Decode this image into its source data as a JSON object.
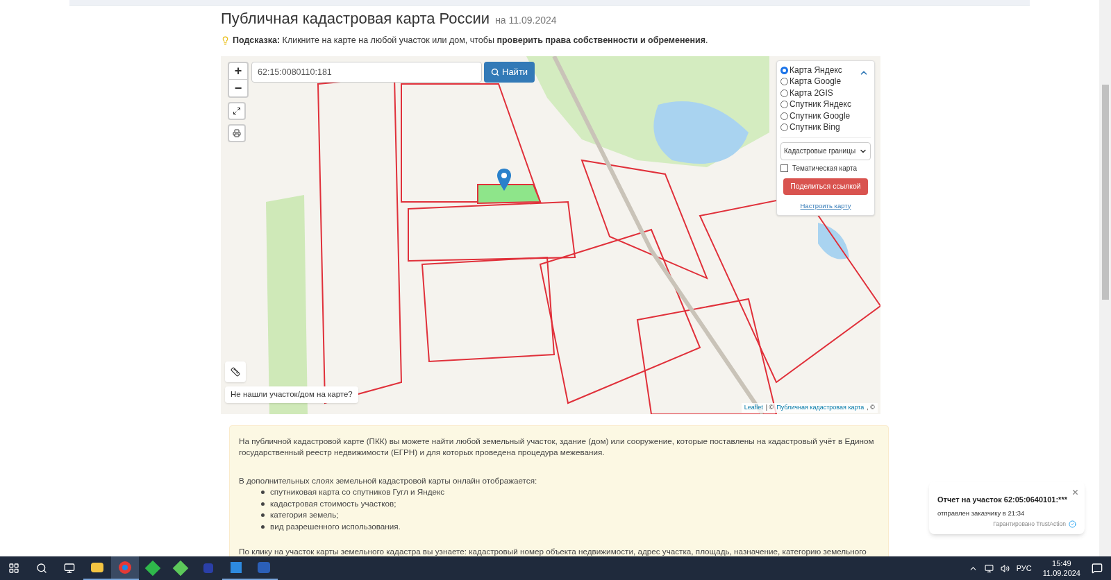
{
  "header": {
    "title": "Публичная кадастровая карта России",
    "date": "на 11.09.2024",
    "hint": "**Подсказка:** Кликните на карте на любой участок или дом, чтобы **проверить права собственности и обременения**."
  },
  "map": {
    "zoom_in": "+",
    "zoom_out": "−",
    "search": {
      "value": "62:15:0080110:181"
    },
    "search_button": "Найти",
    "layers": [
      {
        "label": "Карта Яндекс",
        "selected": true
      },
      {
        "label": "Карта Google",
        "selected": false
      },
      {
        "label": "Карта 2GIS",
        "selected": false
      },
      {
        "label": "Спутник Яндекс",
        "selected": false
      },
      {
        "label": "Спутник Google",
        "selected": false
      },
      {
        "label": "Спутник Bing",
        "selected": false
      }
    ],
    "overlay_select": "Кадастровые границы",
    "thematic": {
      "label": "Тематическая карта",
      "checked": false
    },
    "share_button": "Поделиться ссылкой",
    "settings_link": "Настроить карту",
    "not_found_button": "Не нашли участок/дом на карте?",
    "attribution": {
      "leaflet": "Leaflet",
      "separator": "| ©",
      "source": "Публичная кадастровая карта",
      "tail": ", ©"
    }
  },
  "info": {
    "paragraph_1": "На публичной кадастровой карте (ПКК) вы можете найти любой земельный участок, здание (дом) или сооружение, которые поставлены на кадастровый учёт в Едином государственный реестр недвижимости (ЕГРН) и для которых проведена процедура межевания.",
    "paragraph_2": "В дополнительных слоях земельной кадастровой карты онлайн отображается:",
    "bullets": [
      "спутниковая карта со спутников Гугл и Яндекс",
      "кадастровая стоимость участков;",
      "категория земель;",
      "вид разрешенного использования."
    ],
    "paragraph_3": "По клику на участок карты земельного кадастра вы узнаете: кадастровый номер объекта недвижимости, адрес участка, площадь, назначение, категорию земельного"
  },
  "notification": {
    "title": "Отчет на участок 62:05:0640101:***",
    "text": "отправлен заказчику в 21:34",
    "verified": "Гарантировано TrustAction"
  },
  "taskbar": {
    "language": "РУС",
    "time": "15:49",
    "date": "11.09.2024"
  }
}
